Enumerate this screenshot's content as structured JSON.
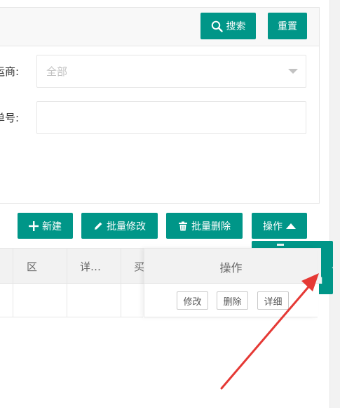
{
  "search": {
    "search_label": "搜索",
    "reset_label": "重置"
  },
  "form": {
    "carrier_label": "运商:",
    "carrier_value": "全部",
    "order_label": "单号:",
    "order_value": ""
  },
  "toolbar": {
    "new_label": "新建",
    "batch_edit_label": "批量修改",
    "batch_delete_label": "批量删除",
    "actions_label": "操作"
  },
  "table": {
    "headers": [
      "区",
      "详…",
      "买"
    ],
    "fixed_header": "操作",
    "row_actions": [
      "修改",
      "删除",
      "详细"
    ]
  },
  "dropdown": {
    "partial_text": "l"
  },
  "colors": {
    "primary": "#009688",
    "annotation_arrow": "#e53935"
  }
}
